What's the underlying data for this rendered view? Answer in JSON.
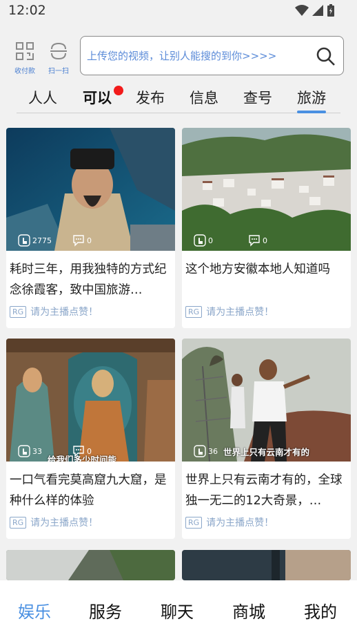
{
  "status_bar": {
    "time": "12:02"
  },
  "quick_actions": [
    {
      "label": "收付款",
      "icon": "qr-grid-icon"
    },
    {
      "label": "扫一扫",
      "icon": "scan-icon"
    }
  ],
  "search": {
    "placeholder": "上传您的视频，让别人能搜的到你>>>>"
  },
  "categories": [
    "人人",
    "可以",
    "发布",
    "信息",
    "查号",
    "旅游"
  ],
  "active_category": "旅游",
  "feed": [
    {
      "title": "耗时三年，用我独特的方式纪念徐霞客，致中国旅游…",
      "likes": "2775",
      "comments": "0",
      "badge": "RG",
      "cta": "请为主播点赞！"
    },
    {
      "title": "这个地方安徽本地人知道吗",
      "likes": "0",
      "comments": "0",
      "badge": "RG",
      "cta": "请为主播点赞！"
    },
    {
      "title": "一口气看完莫高窟九大窟，是种什么样的体验",
      "likes": "33",
      "comments": "0",
      "badge": "RG",
      "cta": "请为主播点赞！",
      "overlay": "给我们多少时间能"
    },
    {
      "title": "世界上只有云南才有的，全球独一无二的12大奇景，…",
      "likes": "36",
      "comments": "",
      "badge": "RG",
      "cta": "请为主播点赞！",
      "overlay": "世界上只有云南才有的"
    }
  ],
  "bottom_nav": [
    "娱乐",
    "服务",
    "聊天",
    "商城",
    "我的"
  ],
  "active_nav": "娱乐",
  "colors": {
    "accent": "#4a90e2",
    "link": "#5b8bd8",
    "badge_red": "#f21b1b"
  }
}
